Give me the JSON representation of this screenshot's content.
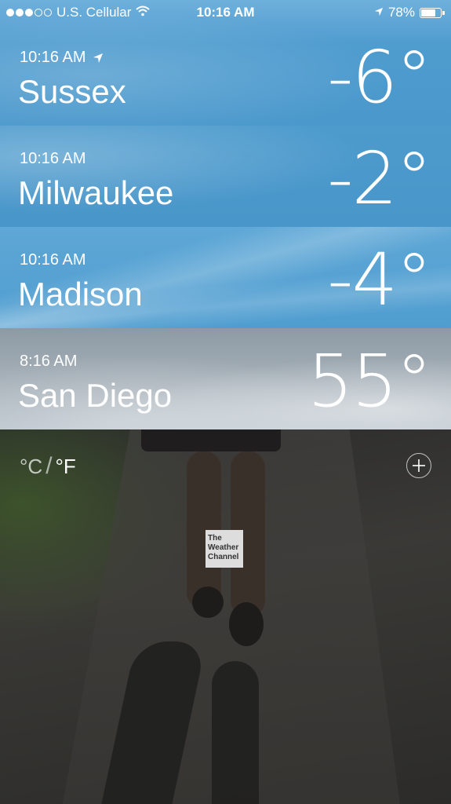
{
  "status_bar": {
    "carrier": "U.S. Cellular",
    "time": "10:16 AM",
    "battery": "78%",
    "battery_level": 0.78,
    "signal_bars_filled": 3,
    "signal_bars_total": 5,
    "icons": [
      "wifi-icon",
      "location-arrow-icon",
      "battery-icon"
    ]
  },
  "cities": [
    {
      "time": "10:16 AM",
      "name": "Sussex",
      "temp": "-6°",
      "current_location": true
    },
    {
      "time": "10:16 AM",
      "name": "Milwaukee",
      "temp": "-2°",
      "current_location": false
    },
    {
      "time": "10:16 AM",
      "name": "Madison",
      "temp": "-4°",
      "current_location": false
    },
    {
      "time": "8:16 AM",
      "name": "San Diego",
      "temp": "55°",
      "current_location": false
    }
  ],
  "bottom_bar": {
    "unit_c": "°C",
    "unit_sep": "/",
    "unit_f": "°F",
    "selected_unit": "F",
    "add_icon": "plus-circle-icon"
  },
  "logo": {
    "line1": "The",
    "line2": "Weather",
    "line3": "Channel"
  }
}
